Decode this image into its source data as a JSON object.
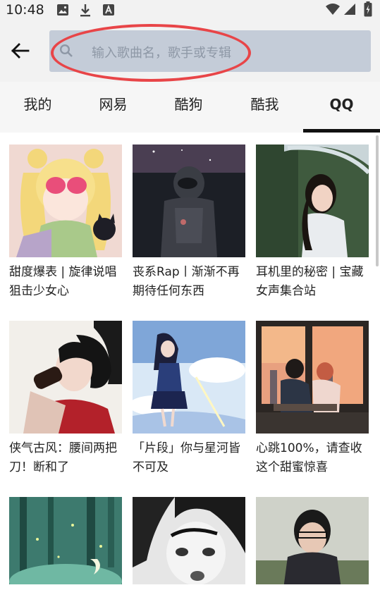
{
  "status_bar": {
    "time": "10:48"
  },
  "search": {
    "placeholder": "输入歌曲名，歌手或专辑"
  },
  "tabs": [
    {
      "label": "我的"
    },
    {
      "label": "网易"
    },
    {
      "label": "酷狗"
    },
    {
      "label": "酷我"
    },
    {
      "label": "QQ"
    }
  ],
  "active_tab": "QQ",
  "playlists": [
    {
      "title": "甜度爆表 | 旋律说唱狙击少女心"
    },
    {
      "title": "丧系Rap丨渐渐不再期待任何东西"
    },
    {
      "title": "耳机里的秘密 | 宝藏女声集合站"
    },
    {
      "title": "侠气古风：腰间两把刀！断和了"
    },
    {
      "title": "「片段」你与星河皆不可及"
    },
    {
      "title": "心跳100%，请查收这个甜蜜惊喜"
    },
    {
      "title": ""
    },
    {
      "title": ""
    },
    {
      "title": ""
    }
  ],
  "colors": {
    "annotation": "#e84548",
    "search_bg": "#c4ccd8",
    "bar_bg": "#f2f2f2"
  }
}
